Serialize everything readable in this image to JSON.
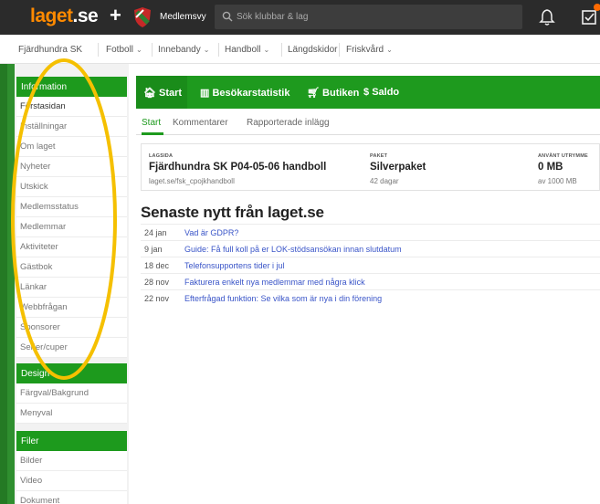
{
  "topbar": {
    "logo_main": "laget",
    "logo_dot": ".se",
    "club_label": "Medlemsvy",
    "search_placeholder": "Sök klubbar & lag"
  },
  "nav": {
    "club": "Fjärdhundra SK",
    "items": [
      "Fotboll",
      "Innebandy",
      "Handboll",
      "Längdskidor",
      "Friskvård"
    ]
  },
  "sidebar": {
    "sections": [
      {
        "header": "Information",
        "items": [
          "Förstasidan",
          "Inställningar",
          "Om laget",
          "Nyheter",
          "Utskick",
          "Medlemsstatus",
          "Medlemmar",
          "Aktiviteter",
          "Gästbok",
          "Länkar",
          "Webbfrågan",
          "Sponsorer",
          "Serier/cuper"
        ]
      },
      {
        "header": "Design",
        "items": [
          "Färgval/Bakgrund",
          "Menyval"
        ]
      },
      {
        "header": "Filer",
        "items": [
          "Bilder",
          "Video",
          "Dokument"
        ]
      }
    ]
  },
  "main": {
    "tabs": [
      "Start",
      "Besökarstatistik",
      "Butiken",
      "Saldo"
    ],
    "subtabs": [
      "Start",
      "Kommentarer",
      "Rapporterade inlägg"
    ],
    "info": {
      "lagsida_label": "LAGSIDA",
      "lagsida_value": "Fjärdhundra SK P04-05-06 handboll",
      "lagsida_sub": "laget.se/fsk_cpojkhandboll",
      "paket_label": "PAKET",
      "paket_value": "Silverpaket",
      "paket_sub": "42 dagar",
      "utrymme_label": "ANVÄNT UTRYMME",
      "utrymme_value": "0 MB",
      "utrymme_sub": "av 1000 MB"
    },
    "news_title": "Senaste nytt från laget.se",
    "news": [
      {
        "date": "24 jan",
        "text": "Vad är GDPR?"
      },
      {
        "date": "9 jan",
        "text": "Guide: Få full koll på er LOK-stödsansökan innan slutdatum"
      },
      {
        "date": "18 dec",
        "text": "Telefonsupportens tider i jul"
      },
      {
        "date": "28 nov",
        "text": "Fakturera enkelt nya medlemmar med några klick"
      },
      {
        "date": "22 nov",
        "text": "Efterfrågad funktion: Se vilka som är nya i din förening"
      }
    ]
  },
  "colors": {
    "brand_green": "#1e9a1e",
    "logo_orange": "#ff8a00",
    "annotation_yellow": "#f5c000",
    "link_blue": "#3a55c8"
  }
}
